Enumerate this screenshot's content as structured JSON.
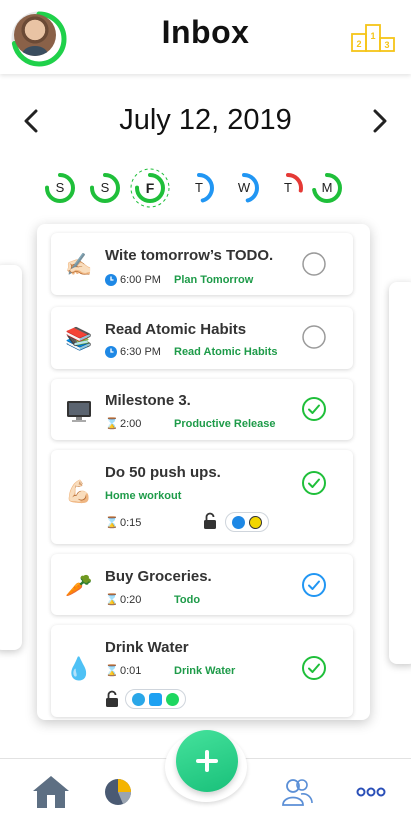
{
  "header": {
    "title": "Inbox",
    "avatar_progress": 0.72,
    "leaderboard_icon": "podium-icon",
    "podium_numbers": [
      "2",
      "1",
      "3"
    ]
  },
  "date_nav": {
    "date": "July 12, 2019",
    "prev_icon": "chevron-left-icon",
    "next_icon": "chevron-right-icon"
  },
  "week": {
    "days": [
      {
        "letter": "S",
        "progress": 0.75,
        "color": "#1fbf3a"
      },
      {
        "letter": "S",
        "progress": 0.75,
        "color": "#1fbf3a"
      },
      {
        "letter": "F",
        "progress": 0.75,
        "color": "#1fbf3a",
        "today": true
      },
      {
        "letter": "T",
        "progress": 0.45,
        "color": "#2196f3"
      },
      {
        "letter": "W",
        "progress": 0.45,
        "color": "#2196f3"
      },
      {
        "letter": "T",
        "progress": 0.28,
        "color": "#e53935"
      },
      {
        "letter": "M",
        "progress": 0.72,
        "color": "#1fbf3a"
      }
    ]
  },
  "tasks": [
    {
      "emoji": "✍🏻",
      "icon": "writing-hand-icon",
      "title": "Wite tomorrow’s TODO.",
      "meta_icon": "clock-icon",
      "time": "6:00 PM",
      "tag": "Plan Tomorrow",
      "status": "pending"
    },
    {
      "emoji": "📚",
      "icon": "books-icon",
      "title": "Read Atomic Habits",
      "meta_icon": "clock-icon",
      "time": "6:30 PM",
      "tag": "Read Atomic Habits",
      "status": "pending"
    },
    {
      "emoji": "🖥️",
      "icon": "computer-icon",
      "title": "Milestone 3.",
      "meta_icon": "hourglass-icon",
      "time": "2:00",
      "tag": "Productive Release",
      "status": "done"
    },
    {
      "emoji": "💪🏻",
      "icon": "flexed-bicep-icon",
      "title": "Do 50 push ups.",
      "meta_icon": "hourglass-icon",
      "time": "0:15",
      "tag": "Home workout",
      "status": "done",
      "apps": [
        "messenger-icon",
        "snapchat-icon"
      ]
    },
    {
      "emoji": "🥕",
      "icon": "carrot-icon",
      "title": "Buy Groceries.",
      "meta_icon": "hourglass-icon",
      "time": "0:20",
      "tag": "Todo",
      "status": "done-blue"
    },
    {
      "emoji": "💧",
      "icon": "droplet-icon",
      "title": "Drink Water",
      "meta_icon": "hourglass-icon",
      "time": "0:01",
      "tag": "Drink Water",
      "status": "done",
      "apps": [
        "skype-icon",
        "twitter-icon",
        "spotify-icon"
      ]
    }
  ],
  "colors": {
    "accent_green": "#1e9b49",
    "check_green": "#1fbf3a",
    "check_blue": "#2196f3",
    "fab": "#2dd68a"
  },
  "bottom_nav": {
    "items": [
      "home-icon",
      "pie-chart-icon",
      "fab-add-button",
      "friends-icon",
      "more-icon"
    ]
  }
}
